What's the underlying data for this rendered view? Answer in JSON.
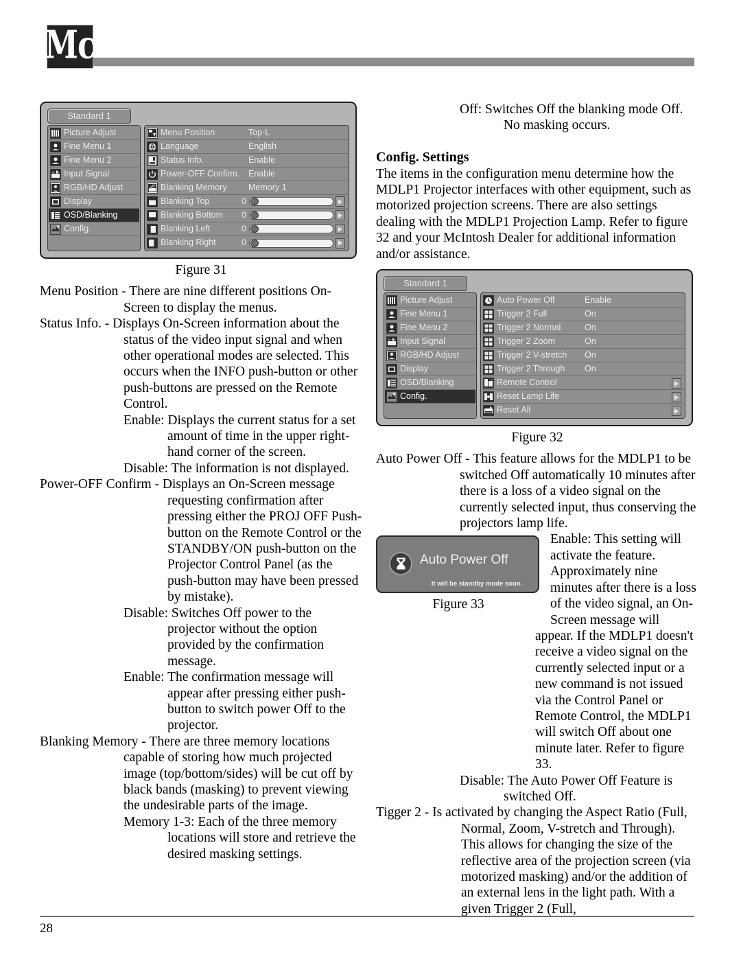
{
  "header": {
    "logo_text": "Mc"
  },
  "footer": {
    "page_number": "28"
  },
  "left_column": {
    "figure31": {
      "caption": "Figure 31",
      "tab_label": "Standard 1",
      "sidebar_items": [
        {
          "label": "Picture Adjust",
          "icon": "picture-adjust-icon",
          "selected": false
        },
        {
          "label": "Fine Menu 1",
          "icon": "fine-menu-1-icon",
          "selected": false
        },
        {
          "label": "Fine Menu 2",
          "icon": "fine-menu-2-icon",
          "selected": false
        },
        {
          "label": "Input Signal",
          "icon": "input-signal-icon",
          "selected": false
        },
        {
          "label": "RGB/HD Adjust",
          "icon": "rgb-hd-adjust-icon",
          "selected": false
        },
        {
          "label": "Display",
          "icon": "display-icon",
          "selected": false
        },
        {
          "label": "OSD/Blanking",
          "icon": "osd-blanking-icon",
          "selected": true
        },
        {
          "label": "Config.",
          "icon": "config-icon",
          "selected": false
        }
      ],
      "rows": [
        {
          "label": "Menu Position",
          "value": "Top-L",
          "icon": "menu-position-icon",
          "type": "value"
        },
        {
          "label": "Language",
          "value": "English",
          "icon": "language-globe-icon",
          "type": "value"
        },
        {
          "label": "Status Info.",
          "value": "Enable",
          "icon": "status-info-icon",
          "type": "value"
        },
        {
          "label": "Power-OFF Confirm.",
          "value": "Enable",
          "icon": "power-icon",
          "type": "value"
        },
        {
          "label": "Blanking Memory",
          "value": "Memory 1",
          "icon": "blanking-memory-icon",
          "type": "value"
        },
        {
          "label": "Blanking Top",
          "value": "0",
          "icon": "blanking-top-icon",
          "type": "slider"
        },
        {
          "label": "Blanking Bottom",
          "value": "0",
          "icon": "blanking-bottom-icon",
          "type": "slider"
        },
        {
          "label": "Blanking Left",
          "value": "0",
          "icon": "blanking-left-icon",
          "type": "slider"
        },
        {
          "label": "Blanking Right",
          "value": "0",
          "icon": "blanking-right-icon",
          "type": "slider"
        }
      ]
    },
    "paragraphs": [
      {
        "style": "hang",
        "text": "Menu Position - There are nine different positions On-Screen to display the menus."
      },
      {
        "style": "hang",
        "text": "Status Info. - Displays On-Screen information about the status of the video input signal and when other operational modes are selected. This occurs when the INFO push-button or other push-buttons are pressed on the Remote Control."
      },
      {
        "style": "hang2",
        "text": "Enable: Displays the current status for a set amount of time in the upper right-hand corner of the screen."
      },
      {
        "style": "hang2",
        "text": "Disable: The information is not displayed."
      },
      {
        "style": "hang-pof",
        "text": "Power-OFF Confirm - Displays an On-Screen message requesting confirmation after pressing either the PROJ OFF Push-button on the Remote Control or the STANDBY/ON push-button on the Projector Control Panel (as the push-button may have been pressed by mistake)."
      },
      {
        "style": "hang2",
        "text": "Disable: Switches Off power to the projector without the option provided by the confirmation message."
      },
      {
        "style": "hang2",
        "text": "Enable: The confirmation message will appear after pressing either push-button to switch power Off to the projector."
      },
      {
        "style": "hang",
        "text": "Blanking Memory - There are three memory locations capable of storing how much projected image (top/bottom/sides) will be cut off by black bands (masking) to prevent viewing the undesirable parts of the image."
      },
      {
        "style": "hang2",
        "text": "Memory 1-3: Each of the three memory locations will store and retrieve the desired masking settings."
      }
    ]
  },
  "right_column": {
    "intro_paragraph": {
      "text": "Off: Switches Off the blanking mode Off. No masking occurs."
    },
    "section_heading": "Config. Settings",
    "section_body": "The items in the configuration menu determine how the MDLP1 Projector interfaces with other equipment, such as motorized projection screens. There are also settings dealing with the MDLP1 Projection Lamp. Refer to figure 32 and your McIntosh Dealer for additional information and/or assistance.",
    "figure32": {
      "caption": "Figure 32",
      "tab_label": "Standard 1",
      "sidebar_items": [
        {
          "label": "Picture Adjust",
          "icon": "picture-adjust-icon",
          "selected": false
        },
        {
          "label": "Fine Menu 1",
          "icon": "fine-menu-1-icon",
          "selected": false
        },
        {
          "label": "Fine Menu 2",
          "icon": "fine-menu-2-icon",
          "selected": false
        },
        {
          "label": "Input Signal",
          "icon": "input-signal-icon",
          "selected": false
        },
        {
          "label": "RGB/HD Adjust",
          "icon": "rgb-hd-adjust-icon",
          "selected": false
        },
        {
          "label": "Display",
          "icon": "display-icon",
          "selected": false
        },
        {
          "label": "OSD/Blanking",
          "icon": "osd-blanking-icon",
          "selected": false
        },
        {
          "label": "Config.",
          "icon": "config-icon",
          "selected": true
        }
      ],
      "rows": [
        {
          "label": "Auto Power Off",
          "value": "Enable",
          "icon": "auto-power-off-icon",
          "type": "value"
        },
        {
          "label": "Trigger 2 Full",
          "value": "On",
          "icon": "trigger-full-icon",
          "type": "value"
        },
        {
          "label": "Trigger 2 Normal",
          "value": "On",
          "icon": "trigger-normal-icon",
          "type": "value"
        },
        {
          "label": "Trigger 2 Zoom",
          "value": "On",
          "icon": "trigger-zoom-icon",
          "type": "value"
        },
        {
          "label": "Trigger 2 V-stretch",
          "value": "On",
          "icon": "trigger-vstretch-icon",
          "type": "value"
        },
        {
          "label": "Trigger 2 Through",
          "value": "On",
          "icon": "trigger-through-icon",
          "type": "value"
        },
        {
          "label": "Remote Control",
          "value": "",
          "icon": "remote-control-icon",
          "type": "submenu"
        },
        {
          "label": "Reset Lamp Life",
          "value": "",
          "icon": "reset-lamp-life-icon",
          "type": "submenu"
        },
        {
          "label": "Reset All",
          "value": "",
          "icon": "reset-all-icon",
          "type": "submenu"
        }
      ]
    },
    "figure33": {
      "caption": "Figure 33",
      "dialog_title": "Auto Power Off",
      "dialog_subtitle": "It will be standby mode soon.",
      "icon": "hourglass-icon"
    },
    "paragraphs_a": [
      {
        "style": "hang",
        "text": "Auto Power Off - This feature allows for the MDLP1 to be switched Off automatically 10 minutes after there is a loss of a video signal on the currently selected input, thus conserving the projectors lamp life."
      }
    ],
    "wrap_paragraph": "Enable: This setting will activate the feature. Approximately nine minutes after there is a loss of the video signal, an On-Screen message will appear. If the MDLP1 doesn't receive a video signal on the currently selected input or a new command is not issued via the Control Panel or Remote Control, the MDLP1 will switch Off about one minute later. Refer to figure 33.",
    "paragraphs_b": [
      {
        "style": "hang2",
        "text": "Disable: The Auto Power Off Feature is switched Off."
      },
      {
        "style": "hang-tig",
        "text": "Tigger 2 - Is activated by changing the Aspect Ratio (Full, Normal, Zoom, V-stretch and Through). This allows for changing the size of the reflective area of the projection screen (via motorized masking) and/or the addition of an external lens in the light path. With a given Trigger 2 (Full,"
      }
    ]
  }
}
